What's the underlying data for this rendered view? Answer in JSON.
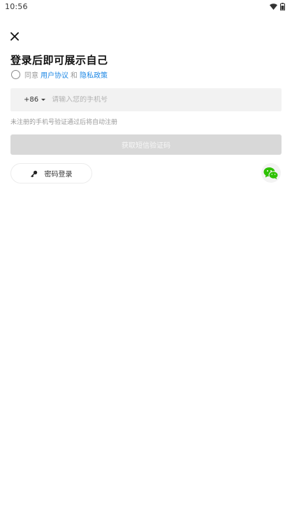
{
  "status_bar": {
    "time": "10:56",
    "icons": [
      "wifi-icon",
      "battery-icon"
    ]
  },
  "header": {
    "close_icon": "close-icon"
  },
  "main": {
    "title": "登录后即可展示自己",
    "agreement": {
      "prefix": "同意",
      "user_agreement": "用户协议",
      "conjunction": "和",
      "privacy_policy": "隐私政策"
    },
    "phone": {
      "country_code": "+86",
      "placeholder": "请输入您的手机号",
      "value": ""
    },
    "hint": "未注册的手机号验证通过后将自动注册",
    "sms_button": "获取短信验证码",
    "password_login_button": "密码登录",
    "password_icon": "key-icon",
    "wechat_icon": "wechat-icon"
  },
  "colors": {
    "link": "#1e88e5",
    "disabled_button": "#d8d8d8",
    "wechat": "#2dc100",
    "input_background": "#f2f2f2"
  }
}
